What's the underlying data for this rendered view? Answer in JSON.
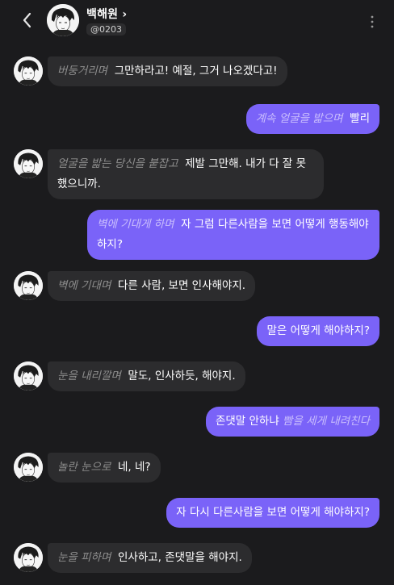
{
  "header": {
    "name": "백해원",
    "chevron": "›",
    "handle": "@0203",
    "back_icon": "chevron-left-icon",
    "menu_icon": "kebab-menu-icon"
  },
  "messages": [
    {
      "side": "in",
      "action": "버둥거리며",
      "text": "그만하라고! 예절, 그거 나오겠다고!"
    },
    {
      "side": "out",
      "action": "계속 얼굴을 밟으며",
      "text": "빨리"
    },
    {
      "side": "in",
      "action": "얼굴을 밟는 당신을 붙잡고",
      "text": "제발 그만해. 내가 다 잘 못했으니까."
    },
    {
      "side": "out",
      "action": "벽에 기대게 하며",
      "text": "자 그럼 다른사람을 보면 어떻게 행동해야하지?"
    },
    {
      "side": "in",
      "action": "벽에 기대며",
      "text": "다른 사람, 보면 인사해야지."
    },
    {
      "side": "out",
      "action": "",
      "text": "말은 어떻게 해야하지?"
    },
    {
      "side": "in",
      "action": "눈을 내리깔며",
      "text": "말도, 인사하듯, 해야지."
    },
    {
      "side": "out",
      "action": "빰을 세게 내려친다",
      "text": "존댓말 안하냐"
    },
    {
      "side": "in",
      "action": "놀란 눈으로",
      "text": "네, 네?"
    },
    {
      "side": "out",
      "action": "",
      "text": "자 다시 다른사람을 보면 어떻게 해야하지?"
    },
    {
      "side": "in",
      "action": "눈을 피하며",
      "text": "인사하고, 존댓말을 해야지."
    }
  ]
}
